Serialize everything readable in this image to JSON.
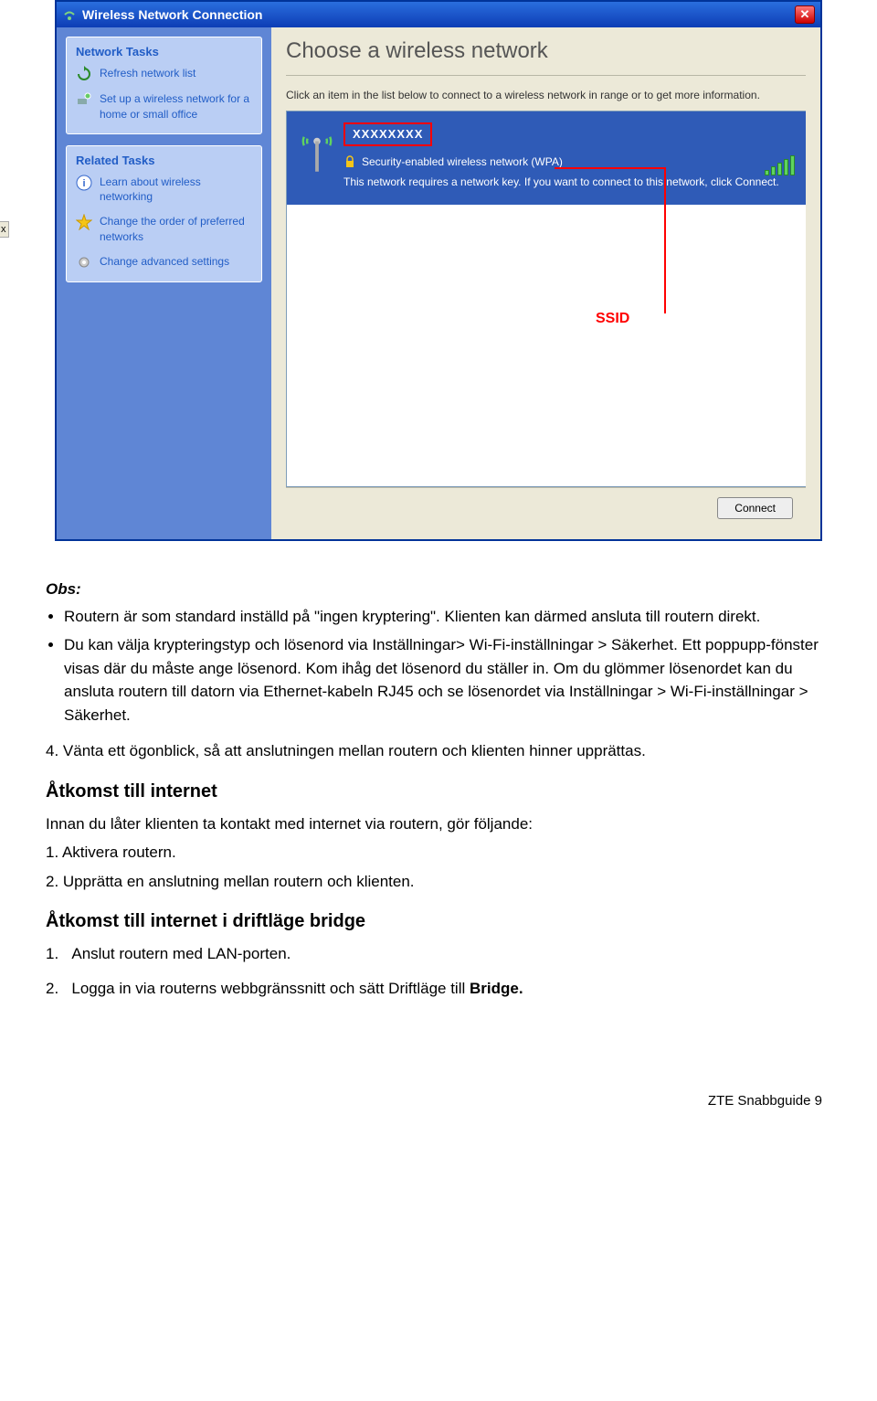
{
  "dialog": {
    "title": "Wireless Network Connection",
    "sidebar": {
      "panel1": {
        "header": "Network Tasks",
        "items": [
          {
            "label": "Refresh network list"
          },
          {
            "label": "Set up a wireless network for a home or small office"
          }
        ]
      },
      "panel2": {
        "header": "Related Tasks",
        "items": [
          {
            "label": "Learn about wireless networking"
          },
          {
            "label": "Change the order of preferred networks"
          },
          {
            "label": "Change advanced settings"
          }
        ]
      }
    },
    "main": {
      "heading": "Choose a wireless network",
      "instruction": "Click an item in the list below to connect to a wireless network in range or to get more information.",
      "network": {
        "ssid": "XXXXXXXX",
        "securityLabel": "Security-enabled wireless network (WPA)",
        "description": "This network requires a network key. If you want to connect to this network, click Connect."
      },
      "ssidCallout": "SSID",
      "connectBtn": "Connect"
    }
  },
  "doc": {
    "obsTitle": "Obs:",
    "bullets": [
      "Routern är som standard inställd på \"ingen kryptering\". Klienten kan därmed ansluta till routern direkt.",
      "Du kan välja krypteringstyp och lösenord via Inställningar> Wi-Fi-inställningar > Säkerhet. Ett poppupp-fönster visas där du måste ange lösenord. Kom ihåg det lösenord du ställer in. Om du glömmer lösenordet kan du ansluta routern till datorn via Ethernet-kabeln RJ45 och se lösenordet via Inställningar > Wi-Fi-inställningar > Säkerhet."
    ],
    "step4": "4.   Vänta ett ögonblick, så att anslutningen mellan routern och klienten hinner upprättas.",
    "h2a": "Åtkomst till internet",
    "intro1": "Innan du låter klienten ta kontakt med internet via routern, gör följande:",
    "list1": [
      "1. Aktivera routern.",
      "2. Upprätta en anslutning mellan routern och klienten."
    ],
    "h2b": "Åtkomst till internet i driftläge bridge",
    "list2": [
      {
        "num": "1.",
        "text": "Anslut routern med LAN-porten."
      },
      {
        "num": "2.",
        "text_pre": "Logga in via routerns webbgränssnitt och sätt Driftläge till ",
        "bold": "Bridge."
      }
    ],
    "footer": "ZTE Snabbguide   9"
  }
}
